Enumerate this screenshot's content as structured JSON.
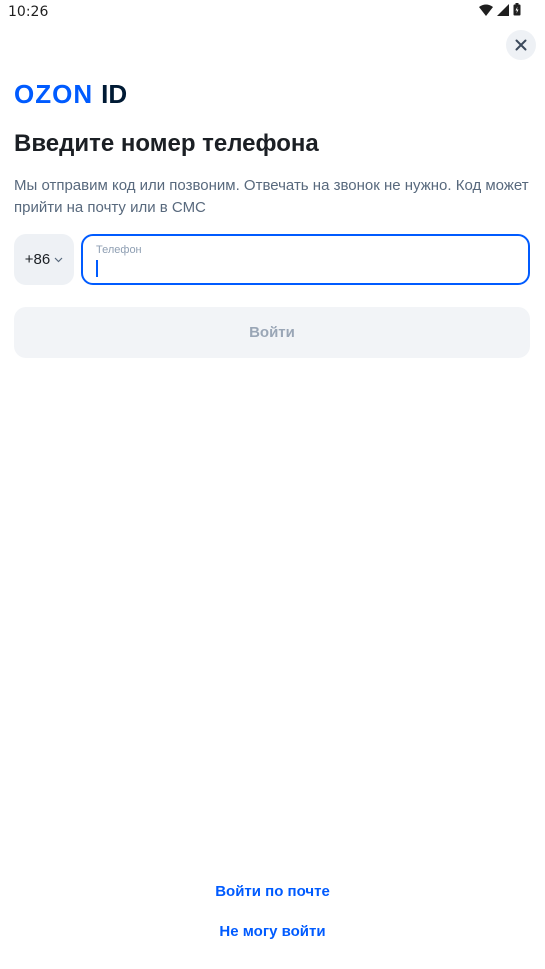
{
  "status_bar": {
    "time": "10:26",
    "icons": [
      "wifi-icon",
      "signal-icon",
      "battery-icon"
    ]
  },
  "header": {
    "close_icon": "close-icon",
    "logo": {
      "brand": "OZON",
      "suffix": "ID"
    }
  },
  "main": {
    "title": "Введите номер телефона",
    "subtitle": "Мы отправим код или позвоним. Отвечать на звонок не нужно. Код может прийти на почту или в СМС",
    "country_code": {
      "value": "+86",
      "icon": "chevron-down-icon"
    },
    "phone_field": {
      "label": "Телефон",
      "value": "",
      "placeholder": ""
    },
    "login_button": "Войти"
  },
  "footer": {
    "login_by_email": "Войти по почте",
    "cant_login": "Не могу войти"
  },
  "colors": {
    "accent": "#005bff",
    "text_primary": "#1b1f24",
    "text_secondary": "#58697d",
    "field_bg": "#eef1f5",
    "button_disabled_bg": "#f2f4f7",
    "button_disabled_text": "#9aa6b6"
  }
}
